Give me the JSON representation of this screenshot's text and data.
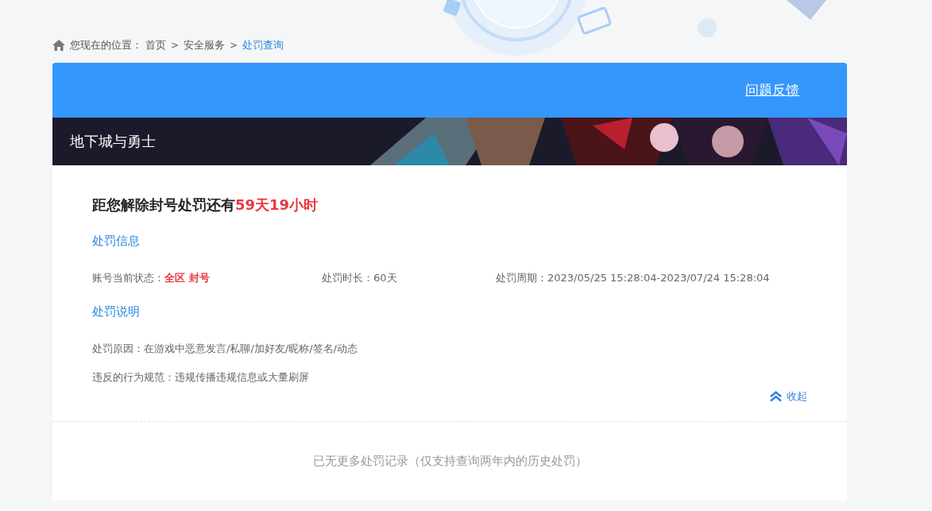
{
  "breadcrumb": {
    "prefix": "您现在的位置：",
    "items": [
      {
        "label": "首页",
        "selected": false
      },
      {
        "label": "安全服务",
        "selected": false
      },
      {
        "label": "处罚查询",
        "selected": true
      }
    ],
    "separator": ">"
  },
  "header": {
    "feedback_link": "问题反馈"
  },
  "banner": {
    "title": "地下城与勇士"
  },
  "countdown": {
    "text": "距您解除封号处罚还有",
    "remaining": "59天19小时"
  },
  "penalty_info": {
    "heading": "处罚信息",
    "fields": [
      {
        "label": "账号当前状态：",
        "value": "全区 封号",
        "kind": "alert"
      },
      {
        "label": "处罚时长：",
        "value": "60天",
        "kind": "plain"
      },
      {
        "label": "处罚周期：",
        "value": "2023/05/25 15:28:04-2023/07/24 15:28:04",
        "kind": "plain"
      }
    ]
  },
  "penalty_details": {
    "heading": "处罚说明",
    "lines": [
      {
        "label": "处罚原因：",
        "value": "在游戏中恶意发言/私聊/加好友/昵称/签名/动态"
      },
      {
        "label": "违反的行为规范：",
        "value": "违规传播违规信息或大量刷屏"
      }
    ]
  },
  "collapse_link": "收起",
  "footer_note": "已无更多处罚记录（仅支持查询两年内的历史处罚）"
}
